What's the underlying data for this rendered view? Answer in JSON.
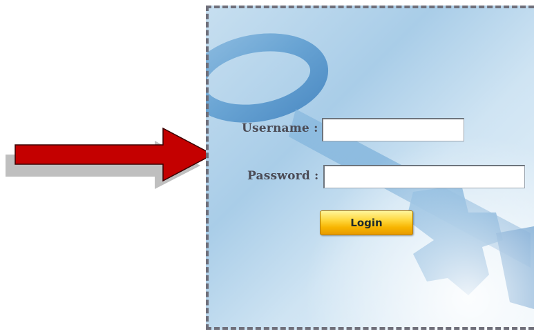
{
  "login_form": {
    "username_label": "Username :",
    "password_label": "Password :",
    "username_value": "",
    "password_value": "",
    "login_label": "Login"
  },
  "icons": {
    "pointer": "red-arrow-icon",
    "key": "key-illustration"
  },
  "colors": {
    "arrow": "#c40000",
    "arrow_shadow": "#bfbfbf",
    "panel_blue": "#a9cde8",
    "button_gold": "#f7b400",
    "label_text": "#4b4b55"
  }
}
